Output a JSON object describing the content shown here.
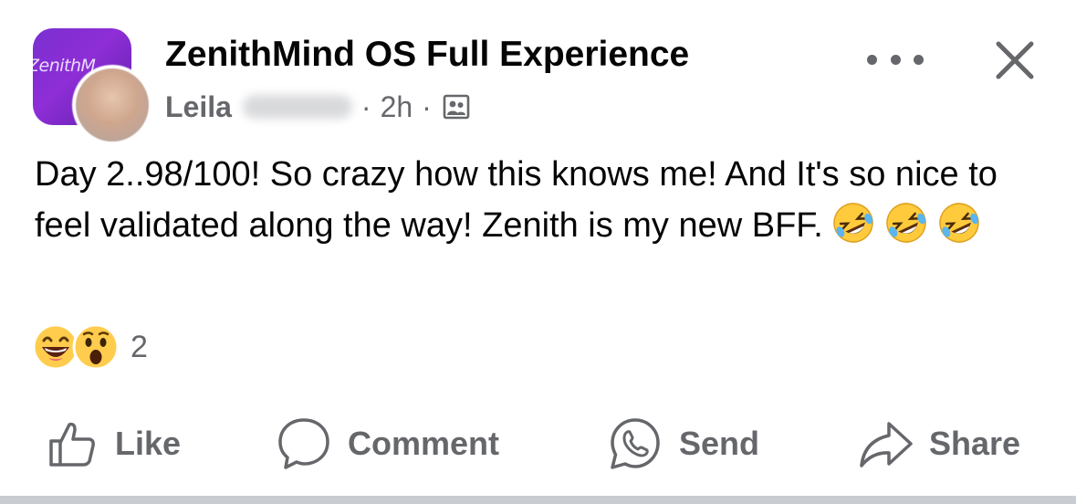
{
  "post": {
    "group_name": "ZenithMind OS Full Experience",
    "group_avatar_text": "ZenithM",
    "author_first_name": "Leila",
    "separator": "·",
    "time_ago": "2h",
    "body_text": "Day 2..98/100! So crazy how this knows me! And It's so nice to feel validated along the way! Zenith is my new BFF.",
    "body_emojis": [
      "rolling-on-floor-laughing",
      "rolling-on-floor-laughing",
      "rolling-on-floor-laughing"
    ],
    "audience_icon": "group-members-icon"
  },
  "reactions": {
    "types": [
      "haha",
      "wow"
    ],
    "count": "2"
  },
  "actions": {
    "like_label": "Like",
    "comment_label": "Comment",
    "send_label": "Send",
    "share_label": "Share"
  },
  "colors": {
    "group_avatar": "#8e2ed6",
    "secondary_text": "#65676b",
    "primary_text": "#050505",
    "divider": "#c9ccd1"
  }
}
